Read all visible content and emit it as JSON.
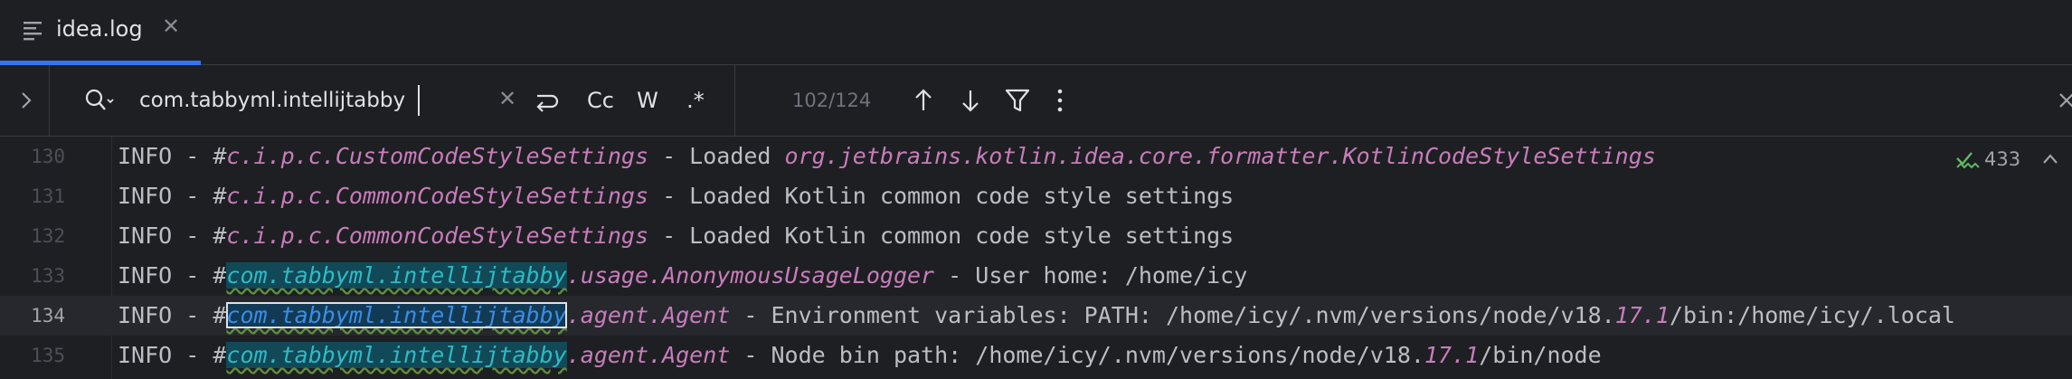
{
  "tab": {
    "icon": "text-lines-icon",
    "label": "idea.log",
    "close_icon": "close-icon",
    "close_glyph": "✕"
  },
  "search": {
    "expand_icon": "chevron-right-icon",
    "search_icon": "search-history-icon",
    "query": "com.tabbyml.intellijtabby",
    "clear_glyph": "✕",
    "options": {
      "regex_newline_icon": "new-line-icon",
      "match_case_label": "Cc",
      "words_label": "W",
      "regex_label": ".*"
    },
    "match_count": "102/124",
    "prev_icon": "arrow-up-icon",
    "next_icon": "arrow-down-icon",
    "filter_icon": "filter-icon",
    "more_icon": "more-vertical-icon",
    "close_icon": "close-icon"
  },
  "inspections": {
    "icon": "double-check-icon",
    "count": "433",
    "collapse_icon": "chevron-up-icon"
  },
  "colors": {
    "accent": "#3574f0",
    "match_highlight": "#114957",
    "class_name": "#c77dbb",
    "match_text": "#2fbac5"
  },
  "lines": [
    {
      "number": "130",
      "prefix": "INFO - #",
      "match": "",
      "logger": "c.i.p.c.CustomCodeStyleSettings",
      "message_a": " - Loaded ",
      "message_cls": "org.jetbrains.kotlin.idea.core.formatter.KotlinCodeStyleSettings",
      "message_b": "",
      "num": "",
      "message_c": ""
    },
    {
      "number": "131",
      "prefix": "INFO - #",
      "match": "",
      "logger": "c.i.p.c.CommonCodeStyleSettings",
      "message_a": " - Loaded Kotlin common code style settings",
      "message_cls": "",
      "message_b": "",
      "num": "",
      "message_c": ""
    },
    {
      "number": "132",
      "prefix": "INFO - #",
      "match": "",
      "logger": "c.i.p.c.CommonCodeStyleSettings",
      "message_a": " - Loaded Kotlin common code style settings",
      "message_cls": "",
      "message_b": "",
      "num": "",
      "message_c": ""
    },
    {
      "number": "133",
      "prefix": "INFO - #",
      "match": "com.tabbyml.intellijtabby",
      "logger": ".usage.AnonymousUsageLogger",
      "message_a": " - User home: /home/icy",
      "message_cls": "",
      "message_b": "",
      "num": "",
      "message_c": ""
    },
    {
      "number": "134",
      "prefix": "INFO - #",
      "match": "com.tabbyml.intellijtabby",
      "logger": ".agent.Agent",
      "message_a": " - Environment variables: PATH: /home/icy/.nvm/versions/node/v18.",
      "message_cls": "",
      "message_b": "",
      "num": "17.1",
      "message_c": "/bin:/home/icy/.local"
    },
    {
      "number": "135",
      "prefix": "INFO - #",
      "match": "com.tabbyml.intellijtabby",
      "logger": ".agent.Agent",
      "message_a": " - Node bin path: /home/icy/.nvm/versions/node/v18.",
      "message_cls": "",
      "message_b": "",
      "num": "17.1",
      "message_c": "/bin/node"
    }
  ]
}
